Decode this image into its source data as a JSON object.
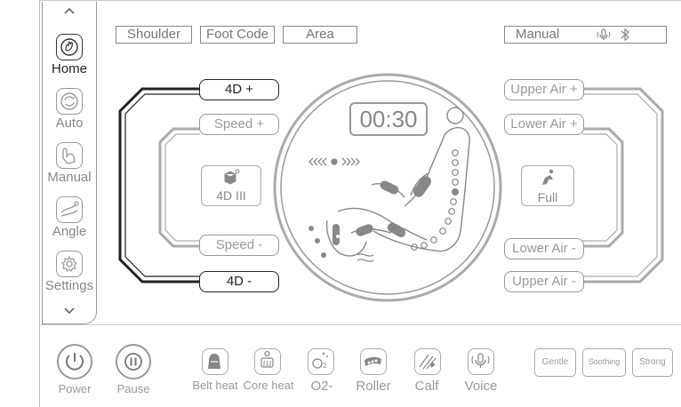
{
  "sidebar": {
    "items": [
      {
        "label": "Home",
        "icon": "hand-massage-icon",
        "active": true
      },
      {
        "label": "Auto",
        "icon": "auto-cycle-icon",
        "active": false
      },
      {
        "label": "Manual",
        "icon": "hand-pointer-icon",
        "active": false
      },
      {
        "label": "Angle",
        "icon": "recline-angle-icon",
        "active": false
      },
      {
        "label": "Settings",
        "icon": "gear-icon",
        "active": false
      }
    ],
    "up_icon": "chevron-up-icon",
    "down_icon": "chevron-down-icon"
  },
  "top": {
    "shoulder": "Shoulder",
    "foot_code": "Foot Code",
    "area": "Area",
    "mode": "Manual",
    "voice_icon": "microphone-icon",
    "bluetooth_icon": "bluetooth-icon"
  },
  "left_controls": {
    "d4_plus": "4D +",
    "speed_plus": "Speed +",
    "d4_mode": "4D III",
    "speed_minus": "Speed -",
    "d4_minus": "4D -"
  },
  "right_controls": {
    "upper_air_plus": "Upper Air +",
    "lower_air_plus": "Lower Air +",
    "air_mode": "Full",
    "lower_air_minus": "Lower Air -",
    "upper_air_minus": "Upper Air -"
  },
  "center": {
    "timer": "00:30"
  },
  "bottom": {
    "power": "Power",
    "pause": "Pause",
    "functions": [
      {
        "label": "Belt heat",
        "icon": "belt-heat-icon"
      },
      {
        "label": "Core heat",
        "icon": "core-heat-icon"
      },
      {
        "label": "O2-",
        "icon": "oxygen-icon"
      },
      {
        "label": "Roller",
        "icon": "roller-icon"
      },
      {
        "label": "Calf",
        "icon": "calf-icon"
      },
      {
        "label": "Voice",
        "icon": "voice-icon"
      }
    ],
    "modes": [
      "Gentle",
      "Soothing",
      "Strong"
    ]
  },
  "colors": {
    "active": "#222222",
    "inactive": "#999999"
  }
}
